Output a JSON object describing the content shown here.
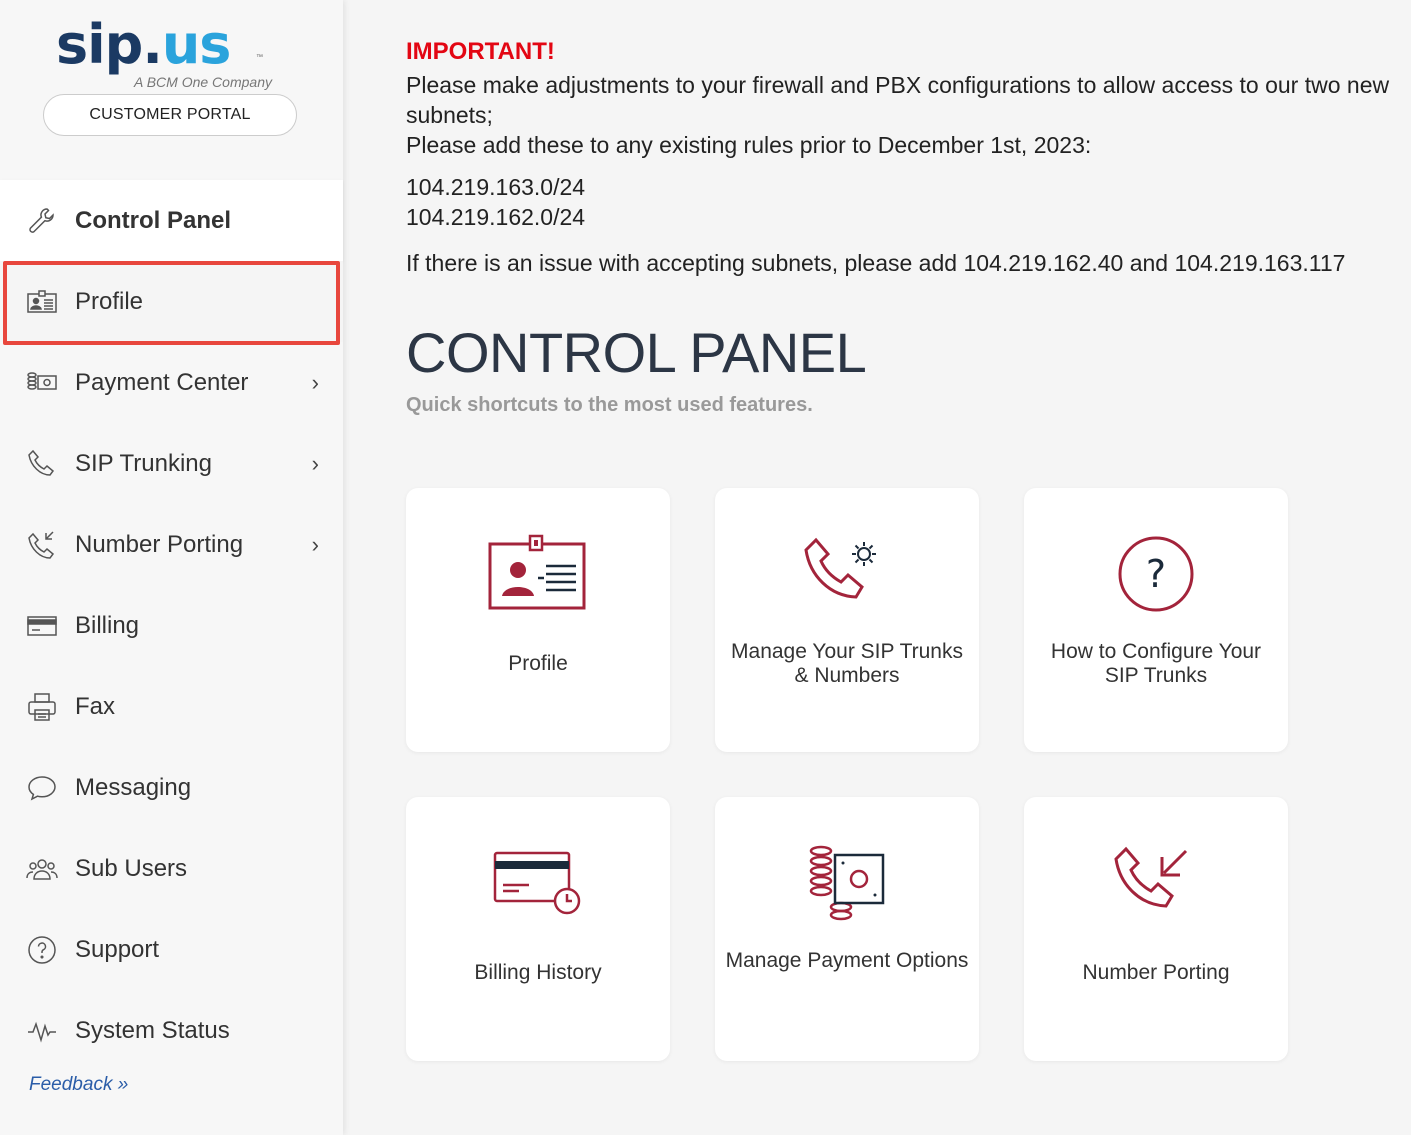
{
  "logo": {
    "brand_sip": "sip",
    "brand_dot": ".",
    "brand_us": "us",
    "tm": "™",
    "tagline": "A BCM One Company"
  },
  "portal_button": "CUSTOMER PORTAL",
  "sidebar": {
    "items": [
      {
        "label": "Control Panel",
        "icon": "wrench-icon"
      },
      {
        "label": "Profile",
        "icon": "id-card-icon"
      },
      {
        "label": "Payment Center",
        "icon": "payment-icon",
        "chevron": "›"
      },
      {
        "label": "SIP Trunking",
        "icon": "phone-icon",
        "chevron": "›"
      },
      {
        "label": "Number Porting",
        "icon": "phone-incoming-icon",
        "chevron": "›"
      },
      {
        "label": "Billing",
        "icon": "credit-card-icon"
      },
      {
        "label": "Fax",
        "icon": "fax-icon"
      },
      {
        "label": "Messaging",
        "icon": "chat-bubble-icon"
      },
      {
        "label": "Sub Users",
        "icon": "users-icon"
      },
      {
        "label": "Support",
        "icon": "help-circle-icon"
      },
      {
        "label": "System Status",
        "icon": "activity-icon"
      }
    ],
    "feedback": "Feedback »"
  },
  "notice": {
    "important": "IMPORTANT!",
    "line1": "Please make adjustments to your firewall and PBX configurations to allow access to our two new subnets;",
    "line2": "Please add these to any existing rules prior to December 1st, 2023:",
    "subnet1": "104.219.163.0/24",
    "subnet2": "104.219.162.0/24",
    "issue": "If there is an issue with accepting subnets, please add 104.219.162.40 and 104.219.163.117"
  },
  "control_panel": {
    "title": "CONTROL PANEL",
    "subtitle": "Quick shortcuts to the most used features.",
    "cards": [
      {
        "label": "Profile",
        "icon": "id-card-icon"
      },
      {
        "label": "Manage Your SIP Trunks & Numbers",
        "icon": "phone-gear-icon"
      },
      {
        "label": "How to Configure Your SIP Trunks",
        "icon": "question-icon"
      },
      {
        "label": "Billing History",
        "icon": "card-history-icon"
      },
      {
        "label": "Manage Payment Options",
        "icon": "coins-bill-icon"
      },
      {
        "label": "Number Porting",
        "icon": "phone-incoming-icon"
      }
    ]
  },
  "colors": {
    "accent": "#a3243b",
    "brand_dark": "#1b3a63",
    "brand_light": "#2aa3dc",
    "important": "#e30613",
    "highlight_border": "#e8473d",
    "link": "#2b5da8"
  }
}
